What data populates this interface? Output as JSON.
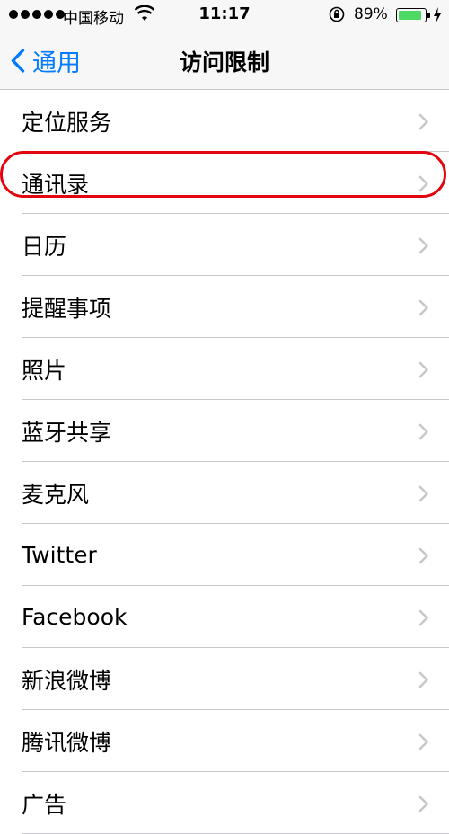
{
  "status_bar": {
    "carrier": "中国移动",
    "time": "11:17",
    "battery_percent": "89%",
    "battery_level": 0.89
  },
  "nav": {
    "back_label": "通用",
    "title": "访问限制"
  },
  "items": [
    {
      "label": "定位服务"
    },
    {
      "label": "通讯录"
    },
    {
      "label": "日历"
    },
    {
      "label": "提醒事项"
    },
    {
      "label": "照片"
    },
    {
      "label": "蓝牙共享"
    },
    {
      "label": "麦克风"
    },
    {
      "label": "Twitter"
    },
    {
      "label": "Facebook"
    },
    {
      "label": "新浪微博"
    },
    {
      "label": "腾讯微博"
    },
    {
      "label": "广告"
    }
  ],
  "colors": {
    "accent": "#007aff",
    "highlight": "#e3050f",
    "battery": "#4cd964"
  }
}
